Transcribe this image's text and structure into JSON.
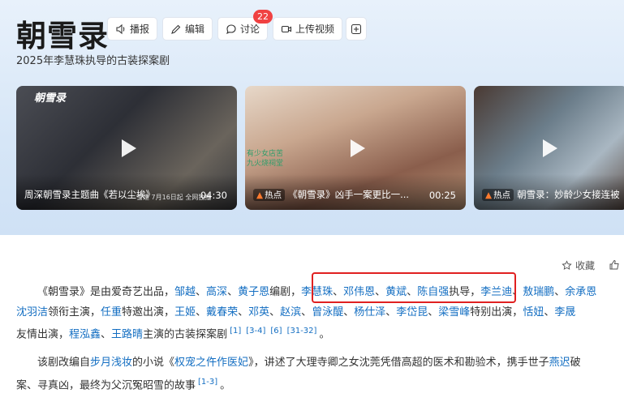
{
  "header": {
    "title": "朝雪录",
    "subtitle": "2025年李慧珠执导的古装探案剧",
    "buttons": [
      {
        "label": "播报",
        "icon": "speaker-icon"
      },
      {
        "label": "编辑",
        "icon": "pencil-icon"
      },
      {
        "label": "讨论",
        "icon": "chat-bubble-icon",
        "badge": "22"
      },
      {
        "label": "上传视频",
        "icon": "video-camera-icon"
      },
      {
        "label": "",
        "icon": "plus-icon"
      }
    ]
  },
  "videos": [
    {
      "logo": "朝雪录",
      "caption": "周深朝雪录主题曲《若以尘埃》",
      "small": "雪逢 7月16日起 全网独播",
      "duration": "04:30"
    },
    {
      "tag": "热点",
      "caption": "《朝雪录》凶手一案更比一...",
      "side_text": "有少女店苦\n九火烧祠堂",
      "duration": "00:25"
    },
    {
      "tag": "热点",
      "caption": "朝雪录：妙龄少女接连被"
    }
  ],
  "actions": {
    "collect": "收藏"
  },
  "paragraph1": {
    "line1": {
      "p1": "《朝雪录》是由爱奇艺出品，",
      "w1": "邹越",
      "s1": "、",
      "w2": "高深",
      "s2": "、",
      "w3": "黄子恩",
      "p2": "编剧，",
      "d1": "李慧珠",
      "s3": "、",
      "d2": "邓伟恩",
      "s4": "、",
      "d3": "黄斌",
      "s5": "、",
      "d4": "陈自强",
      "p3": "执导，",
      "a1": "李兰迪",
      "s6": "、",
      "a2": "敖瑞鹏",
      "s7": "、",
      "a3": "余承恩"
    },
    "line2": {
      "a4": "沈羽洁",
      "p1": "领衔主演，",
      "a5": "任重",
      "p2": "特邀出演，",
      "a6": "王姬",
      "s1": "、",
      "a7": "戴春荣",
      "s2": "、",
      "a8": "邓英",
      "s3": "、",
      "a9": "赵滨",
      "s4": "、",
      "a10": "曾泳醍",
      "s5": "、",
      "a11": "杨仕泽",
      "s6": "、",
      "a12": "李岱昆",
      "s7": "、",
      "a13": "梁雪峰",
      "p3": "特别出演，",
      "a14": "恬妞",
      "s8": "、",
      "a15": "李晟"
    },
    "line3": {
      "p1": "友情出演，",
      "a16": "程泓鑫",
      "s1": "、",
      "a17": "王路晴",
      "p2": "主演的古装探案剧",
      "r1": "[1]",
      "r2": "[3-4]",
      "r3": "[6]",
      "r4": "[31-32]",
      "end": "。"
    }
  },
  "paragraph2": {
    "line1": {
      "p1": "该剧改编自",
      "author": "步月浅妆",
      "p2": "的小说《",
      "novel": "权宠之仵作医妃",
      "p3": "》，讲述了大理寺卿之女沈莞凭借高超的医术和勘验术，携手世子",
      "ch": "燕迟",
      "p4": "破"
    },
    "line2": {
      "p1": "案、寻真凶，最终为父沉冤昭雪的故事",
      "r1": "[1-3]",
      "end": "。"
    }
  }
}
